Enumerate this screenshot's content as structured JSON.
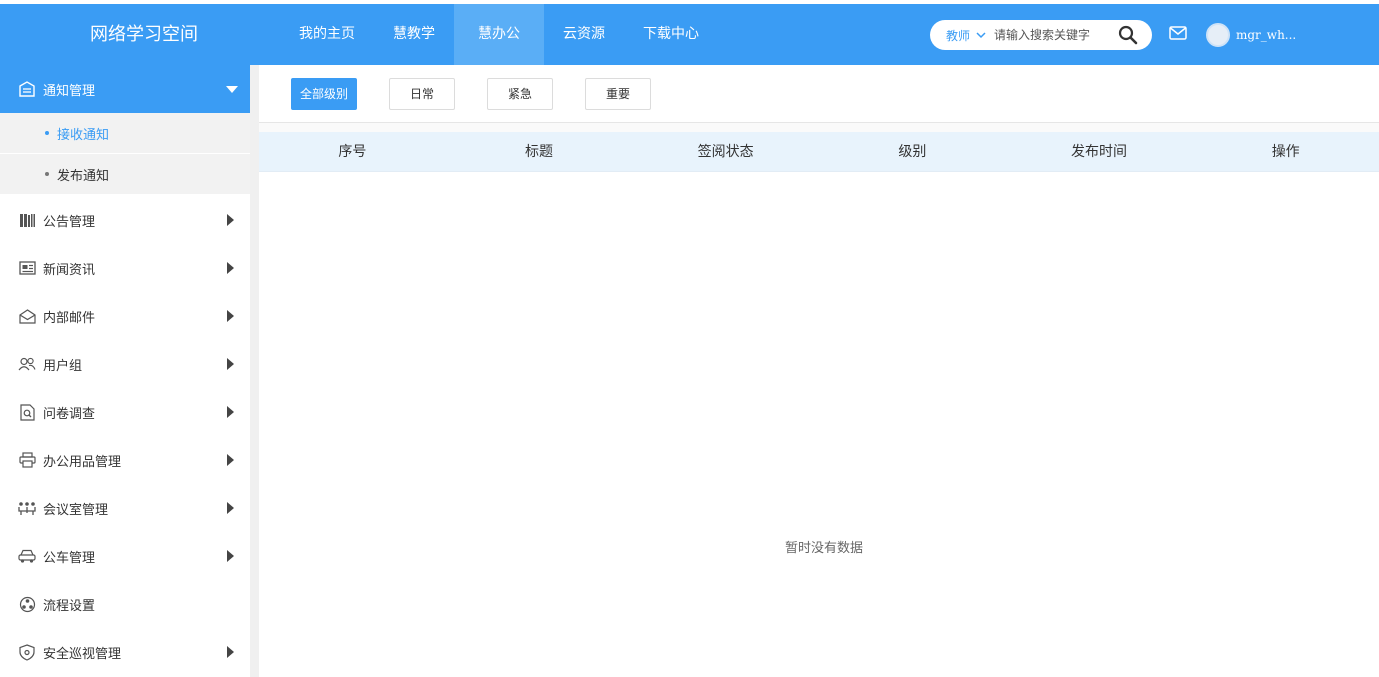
{
  "header": {
    "logo": "网络学习空间",
    "nav": [
      "我的主页",
      "慧教学",
      "慧办公",
      "云资源",
      "下载中心"
    ],
    "active_nav": "慧办公",
    "search": {
      "type": "教师",
      "placeholder": "请输入搜索关键字"
    },
    "username": "mgr_wh..."
  },
  "sidebar": {
    "active_menu": {
      "label": "通知管理",
      "icon": "notice-icon"
    },
    "submenu": [
      {
        "label": "接收通知",
        "active": true
      },
      {
        "label": "发布通知",
        "active": false
      }
    ],
    "items": [
      {
        "label": "公告管理",
        "icon": "books-icon",
        "has_arrow": true
      },
      {
        "label": "新闻资讯",
        "icon": "news-icon",
        "has_arrow": true
      },
      {
        "label": "内部邮件",
        "icon": "open-mail-icon",
        "has_arrow": true
      },
      {
        "label": "用户组",
        "icon": "user-group-icon",
        "has_arrow": true
      },
      {
        "label": "问卷调查",
        "icon": "survey-icon",
        "has_arrow": true
      },
      {
        "label": "办公用品管理",
        "icon": "printer-icon",
        "has_arrow": true
      },
      {
        "label": "会议室管理",
        "icon": "meeting-icon",
        "has_arrow": true
      },
      {
        "label": "公车管理",
        "icon": "car-icon",
        "has_arrow": true
      },
      {
        "label": "流程设置",
        "icon": "workflow-icon",
        "has_arrow": false
      },
      {
        "label": "安全巡视管理",
        "icon": "shield-icon",
        "has_arrow": true
      }
    ]
  },
  "filters": [
    "全部级别",
    "日常",
    "紧急",
    "重要"
  ],
  "active_filter": "全部级别",
  "table": {
    "columns": [
      "序号",
      "标题",
      "签阅状态",
      "级别",
      "发布时间",
      "操作"
    ],
    "rows": [],
    "empty_text": "暂时没有数据"
  },
  "colors": {
    "primary": "#3a9cf4",
    "active_nav": "#5aaef6",
    "table_header": "#e8f3fc"
  }
}
